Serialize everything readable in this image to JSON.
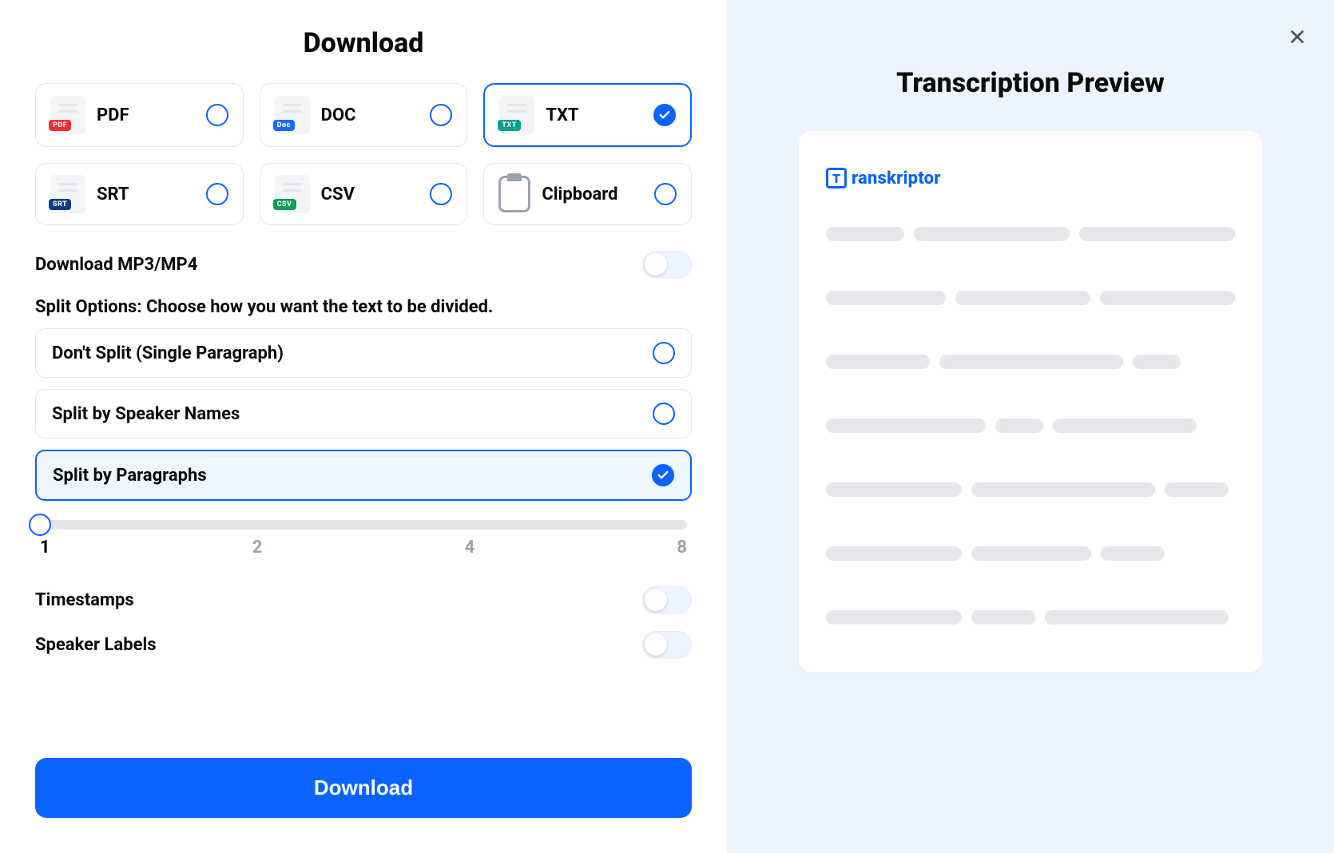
{
  "title": "Download",
  "preview_title": "Transcription Preview",
  "brand": "ranskriptor",
  "brand_letter": "T",
  "formats": [
    {
      "label": "PDF",
      "badge_text": "PDF",
      "badge_class": "badge-red",
      "selected": false
    },
    {
      "label": "DOC",
      "badge_text": "Doc",
      "badge_class": "badge-blue",
      "selected": false
    },
    {
      "label": "TXT",
      "badge_text": "TXT",
      "badge_class": "badge-teal",
      "selected": true
    },
    {
      "label": "SRT",
      "badge_text": "SRT",
      "badge_class": "badge-navy",
      "selected": false
    },
    {
      "label": "CSV",
      "badge_text": "CSV",
      "badge_class": "badge-green",
      "selected": false
    },
    {
      "label": "Clipboard",
      "clipboard": true,
      "selected": false
    }
  ],
  "mp3_label": "Download MP3/MP4",
  "mp3_on": false,
  "split_heading": "Split Options: Choose how you want the text to be divided.",
  "split_options": [
    {
      "label": "Don't Split (Single Paragraph)",
      "selected": false
    },
    {
      "label": "Split by Speaker Names",
      "selected": false
    },
    {
      "label": "Split by Paragraphs",
      "selected": true
    }
  ],
  "slider": {
    "value": 1,
    "ticks": [
      "1",
      "2",
      "4",
      "8"
    ]
  },
  "timestamps_label": "Timestamps",
  "timestamps_on": false,
  "speaker_labels_label": "Speaker Labels",
  "speaker_labels_on": false,
  "download_button": "Download"
}
